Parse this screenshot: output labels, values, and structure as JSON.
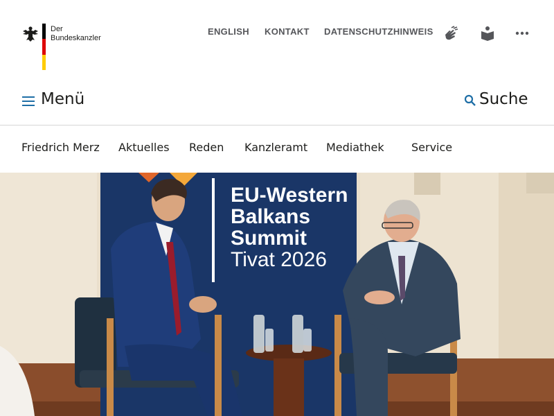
{
  "logo": {
    "line1": "Der",
    "line2": "Bundeskanzler",
    "flag_colors": [
      "#000000",
      "#dd0000",
      "#ffcc00"
    ]
  },
  "utility_nav": {
    "links": [
      "ENGLISH",
      "KONTAKT",
      "DATENSCHUTZHINWEIS"
    ],
    "icons": [
      "sign-language-icon",
      "easy-language-icon",
      "more-icon"
    ]
  },
  "menu": {
    "label": "Menü",
    "icon": "hamburger-icon"
  },
  "search": {
    "label": "Suche",
    "icon": "search-icon"
  },
  "main_nav": [
    "Friedrich Merz",
    "Aktuelles",
    "Reden",
    "Kanzleramt",
    "Mediathek",
    "Service"
  ],
  "hero": {
    "banner_lines": [
      "EU-Western",
      "Balkans",
      "Summit",
      "Tivat 2026"
    ]
  },
  "colors": {
    "accent": "#1e6ea6",
    "banner_blue": "#1c3a6e",
    "text": "#1d1d1b",
    "util_text": "#55565a"
  }
}
